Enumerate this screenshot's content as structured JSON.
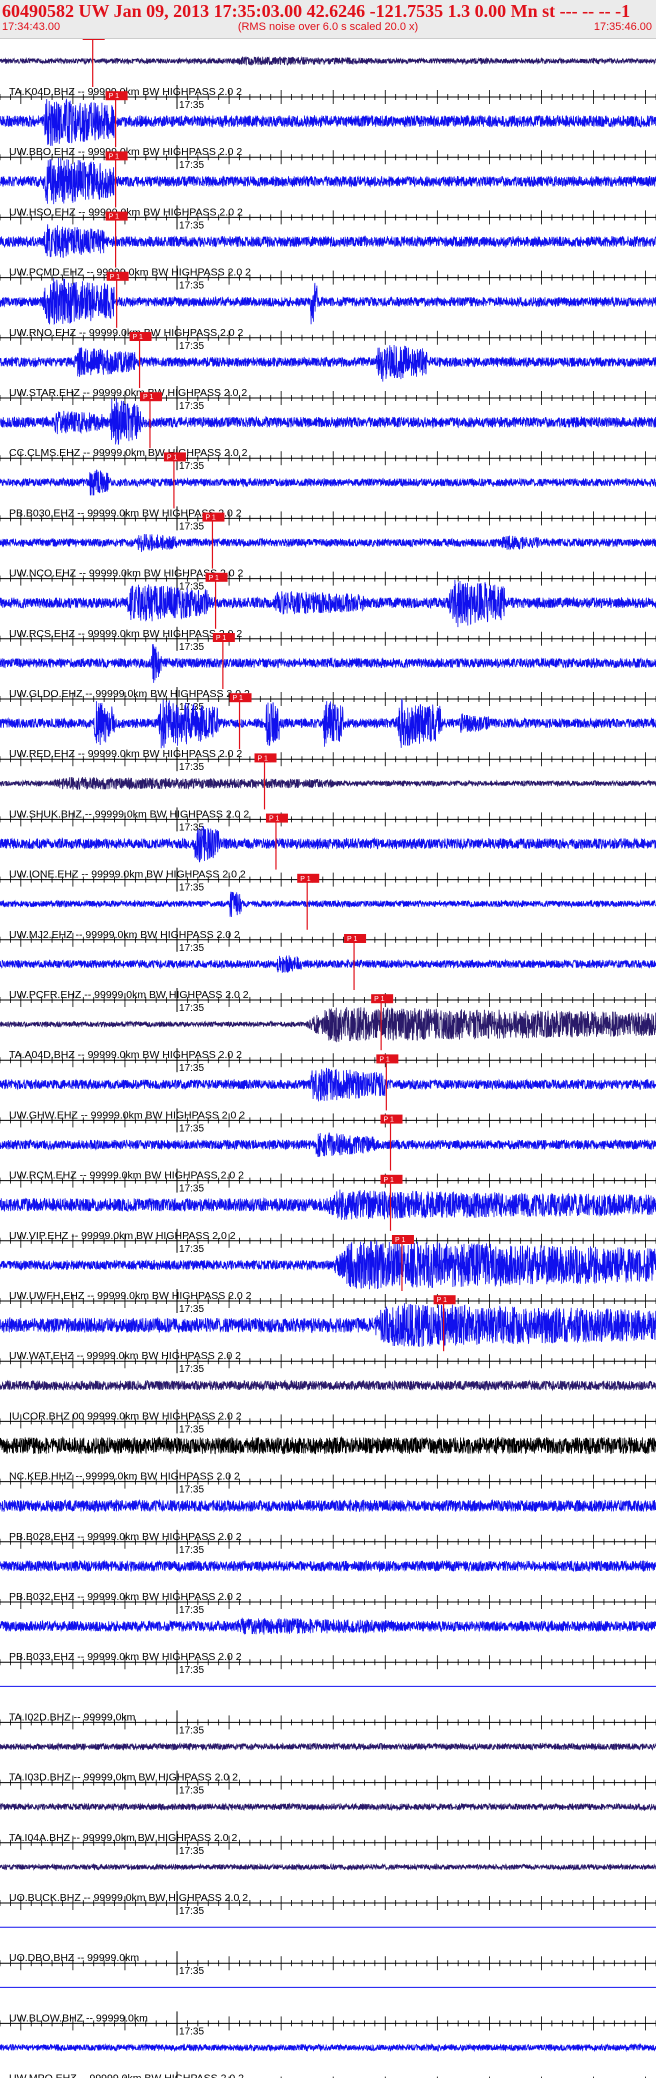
{
  "header": {
    "title": "60490582 UW Jan 09, 2013 17:35:03.00   42.6246 -121.7535  1.3 0.00 Mn st --- -- --  -1",
    "start_time": "17:34:43.00",
    "subtitle": "(RMS noise over 6.0 s scaled 20.0 x)",
    "end_time": "17:35:46.00"
  },
  "chart_data": {
    "type": "line",
    "title": "60490582 UW Jan 09, 2013 17:35:03.00   42.6246 -121.7535  1.3 0.00 Mn st --- -- --  -1",
    "x_range": [
      "17:34:43.00",
      "17:35:46.00"
    ],
    "x_tick_label": "17:35",
    "pick_label": "P 1",
    "grid": false,
    "colors": {
      "trace": "#1010ee",
      "trace_dark": "#2a1a6a",
      "trace_black": "#000000",
      "pick": "#e0111b",
      "axis": "#000000"
    },
    "series": [
      {
        "name": "TA.K04D.BHZ.--",
        "label": "TA.K04D.BHZ -- 99999.0km BW  HIGHPASS  2.0  2",
        "pick_s": 1.7,
        "noise": 0.1,
        "color": "dark",
        "bursts": [
          [
            22,
            36,
            0.18
          ],
          [
            44,
            52,
            0.12
          ]
        ]
      },
      {
        "name": "UW.BBO.EHZ.--",
        "label": "UW.BBO.EHZ -- 99999.0km BW  HIGHPASS  2.0  2",
        "pick_s": 3.9,
        "noise": 0.22,
        "color": "blue",
        "bursts": [
          [
            4,
            11,
            1.0
          ]
        ]
      },
      {
        "name": "UW.HSO.EHZ.--",
        "label": "UW.HSO.EHZ -- 99999.0km BW  HIGHPASS  2.0  2",
        "pick_s": 3.9,
        "noise": 0.2,
        "color": "blue",
        "bursts": [
          [
            4,
            11,
            1.0
          ]
        ]
      },
      {
        "name": "UW.PCMD.EHZ.--",
        "label": "UW.PCMD.EHZ -- 99999.0km BW  HIGHPASS  2.0  2",
        "pick_s": 3.9,
        "noise": 0.2,
        "color": "blue",
        "bursts": [
          [
            4,
            10,
            0.7
          ]
        ]
      },
      {
        "name": "UW.RNO.EHZ.--",
        "label": "UW.RNO.EHZ -- 99999.0km BW  HIGHPASS  2.0  2",
        "pick_s": 4.0,
        "noise": 0.18,
        "color": "blue",
        "bursts": [
          [
            4,
            11,
            1.0
          ],
          [
            29.8,
            30.6,
            0.9
          ]
        ]
      },
      {
        "name": "UW.STAR.EHZ.--",
        "label": "UW.STAR.EHZ -- 99999.0km BW  HIGHPASS  2.0  2",
        "pick_s": 6.2,
        "noise": 0.18,
        "color": "blue",
        "bursts": [
          [
            7,
            13,
            0.6
          ],
          [
            36,
            41,
            0.8
          ]
        ]
      },
      {
        "name": "CC.CLMS.EHZ.--",
        "label": "CC.CLMS.EHZ -- 99999.0km BW  HIGHPASS  2.0  2",
        "pick_s": 7.2,
        "noise": 0.2,
        "color": "blue",
        "bursts": [
          [
            5,
            10,
            0.5
          ],
          [
            10.5,
            13.5,
            1.0
          ]
        ]
      },
      {
        "name": "PB.B030.EHZ.--",
        "label": "PB.B030.EHZ -- 99999.0km BW  HIGHPASS  2.0  2",
        "pick_s": 9.5,
        "noise": 0.15,
        "color": "blue",
        "bursts": [
          [
            8.5,
            10.5,
            0.6
          ]
        ]
      },
      {
        "name": "UW.NCO.EHZ.--",
        "label": "UW.NCO.EHZ -- 99999.0km BW  HIGHPASS  2.0  2",
        "pick_s": 13.2,
        "noise": 0.15,
        "color": "blue",
        "bursts": [
          [
            13,
            17,
            0.4
          ],
          [
            48,
            52,
            0.3
          ]
        ]
      },
      {
        "name": "UW.RCS.EHZ.--",
        "label": "UW.RCS.EHZ -- 99999.0km BW  HIGHPASS  2.0  2",
        "pick_s": 13.5,
        "noise": 0.2,
        "color": "blue",
        "bursts": [
          [
            12,
            20,
            0.8
          ],
          [
            26,
            35,
            0.5
          ],
          [
            43,
            48.5,
            1.0
          ]
        ]
      },
      {
        "name": "UW.GLDO.EHZ.--",
        "label": "UW.GLDO.EHZ -- 99999.0km BW  HIGHPASS  2.0  2",
        "pick_s": 14.2,
        "noise": 0.18,
        "color": "blue",
        "bursts": [
          [
            14.5,
            15.5,
            0.9
          ]
        ]
      },
      {
        "name": "UW.RED.EHZ.--",
        "label": "UW.RED.EHZ -- 99999.0km BW  HIGHPASS  2.0  2",
        "pick_s": 15.8,
        "noise": 0.18,
        "color": "blue",
        "bursts": [
          [
            9,
            11,
            1.0
          ],
          [
            15,
            21,
            1.0
          ],
          [
            25.5,
            26.8,
            1.0
          ],
          [
            31,
            33,
            1.0
          ],
          [
            38,
            42.5,
            1.0
          ],
          [
            44,
            47,
            0.4
          ]
        ]
      },
      {
        "name": "UW.SHUK.BHZ.--",
        "label": "UW.SHUK.BHZ -- 99999.0km BW  HIGHPASS  2.0  2",
        "pick_s": 18.2,
        "noise": 0.1,
        "color": "dark",
        "bursts": [
          [
            4,
            32,
            0.25
          ]
        ]
      },
      {
        "name": "UW.IONE.EHZ.--",
        "label": "UW.IONE.EHZ -- 99999.0km BW  HIGHPASS  2.0  2",
        "pick_s": 19.3,
        "noise": 0.2,
        "color": "blue",
        "bursts": [
          [
            18.5,
            21,
            0.8
          ]
        ]
      },
      {
        "name": "UW.MJ2.EHZ.--",
        "label": "UW.MJ2.EHZ -- 99999.0km BW  HIGHPASS  2.0  2",
        "pick_s": 22.3,
        "noise": 0.12,
        "color": "blue",
        "bursts": [
          [
            22,
            23.2,
            0.6
          ]
        ]
      },
      {
        "name": "UW.PCFR.EHZ.--",
        "label": "UW.PCFR.EHZ -- 99999.0km BW  HIGHPASS  2.0  2",
        "pick_s": 26.8,
        "noise": 0.15,
        "color": "blue",
        "bursts": [
          [
            26.5,
            29,
            0.4
          ]
        ]
      },
      {
        "name": "TA.A04D.BHZ.--",
        "label": "TA.A04D.BHZ -- 99999.0km BW  HIGHPASS  2.0  2",
        "pick_s": 29.4,
        "noise": 0.1,
        "color": "dark",
        "bursts": [
          [
            29,
            63,
            0.7
          ]
        ]
      },
      {
        "name": "UW.GHW.EHZ.--",
        "label": "UW.GHW.EHZ -- 99999.0km BW  HIGHPASS  2.0  2",
        "pick_s": 29.9,
        "noise": 0.18,
        "color": "blue",
        "bursts": [
          [
            29.5,
            37,
            0.7
          ]
        ]
      },
      {
        "name": "UW.RCM.EHZ.--",
        "label": "UW.RCM.EHZ -- 99999.0km BW  HIGHPASS  2.0  2",
        "pick_s": 30.3,
        "noise": 0.18,
        "color": "blue",
        "bursts": [
          [
            30,
            36,
            0.5
          ]
        ]
      },
      {
        "name": "UW.VIP.EHZ.--",
        "label": "UW.VIP.EHZ -- 99999.0km BW  HIGHPASS  2.0  2",
        "pick_s": 30.3,
        "noise": 0.25,
        "color": "blue",
        "bursts": [
          [
            30,
            63,
            0.6
          ]
        ]
      },
      {
        "name": "UW.UWFH.EHZ.--",
        "label": "UW.UWFH.EHZ -- 99999.0km BW  HIGHPASS  2.0  2",
        "pick_s": 31.4,
        "noise": 0.18,
        "color": "blue",
        "bursts": [
          [
            31.4,
            63,
            1.0
          ]
        ]
      },
      {
        "name": "UW.WAT.EHZ.--",
        "label": "UW.WAT.EHZ -- 99999.0km BW  HIGHPASS  2.0  2",
        "pick_s": 35.4,
        "noise": 0.28,
        "color": "blue",
        "bursts": [
          [
            35,
            63,
            0.9
          ]
        ]
      },
      {
        "name": "IU.COR.BHZ.00",
        "label": "IU.COR.BHZ 00 99999.0km BW  HIGHPASS  2.0  2",
        "pick_s": null,
        "noise": 0.18,
        "color": "dark",
        "bursts": []
      },
      {
        "name": "NC.KEB.HHZ.--",
        "label": "NC.KEB.HHZ -- 99999.0km BW  HIGHPASS  2.0  2",
        "pick_s": null,
        "noise": 0.32,
        "color": "black",
        "bursts": []
      },
      {
        "name": "PB.B028.EHZ.--",
        "label": "PB.B028.EHZ -- 99999.0km BW  HIGHPASS  2.0  2",
        "pick_s": null,
        "noise": 0.22,
        "color": "blue",
        "bursts": []
      },
      {
        "name": "PB.B032.EHZ.--",
        "label": "PB.B032.EHZ -- 99999.0km BW  HIGHPASS  2.0  2",
        "pick_s": null,
        "noise": 0.2,
        "color": "blue",
        "bursts": []
      },
      {
        "name": "PB.B033.EHZ.--",
        "label": "PB.B033.EHZ -- 99999.0km BW  HIGHPASS  2.0  2",
        "pick_s": null,
        "noise": 0.2,
        "color": "blue",
        "bursts": [
          [
            22,
            38,
            0.35
          ]
        ]
      },
      {
        "name": "TA.I02D.BHZ.--",
        "label": "TA.I02D.BHZ -- 99999.0km",
        "pick_s": null,
        "noise": 0.0,
        "color": "flat",
        "bursts": []
      },
      {
        "name": "TA.I03D.BHZ.--",
        "label": "TA.I03D.BHZ -- 99999.0km BW  HIGHPASS  2.0  2",
        "pick_s": null,
        "noise": 0.12,
        "color": "dark",
        "bursts": []
      },
      {
        "name": "TA.I04A.BHZ.--",
        "label": "TA.I04A.BHZ -- 99999.0km BW  HIGHPASS  2.0  2",
        "pick_s": null,
        "noise": 0.12,
        "color": "dark",
        "bursts": []
      },
      {
        "name": "UO.BUCK.BHZ.--",
        "label": "UO.BUCK.BHZ -- 99999.0km BW  HIGHPASS  2.0  2",
        "pick_s": null,
        "noise": 0.1,
        "color": "dark",
        "bursts": []
      },
      {
        "name": "UO.DBO.BHZ.--",
        "label": "UO.DBO.BHZ -- 99999.0km",
        "pick_s": null,
        "noise": 0.0,
        "color": "flat",
        "bursts": []
      },
      {
        "name": "UW.BLOW.BHZ.--",
        "label": "UW.BLOW.BHZ -- 99999.0km",
        "pick_s": null,
        "noise": 0.0,
        "color": "flat",
        "bursts": []
      },
      {
        "name": "UW.MPO.EHZ.--",
        "label": "UW.MPO.EHZ -- 99999.0km BW  HIGHPASS  2.0  2",
        "pick_s": null,
        "noise": 0.12,
        "color": "blue",
        "bursts": []
      }
    ]
  }
}
